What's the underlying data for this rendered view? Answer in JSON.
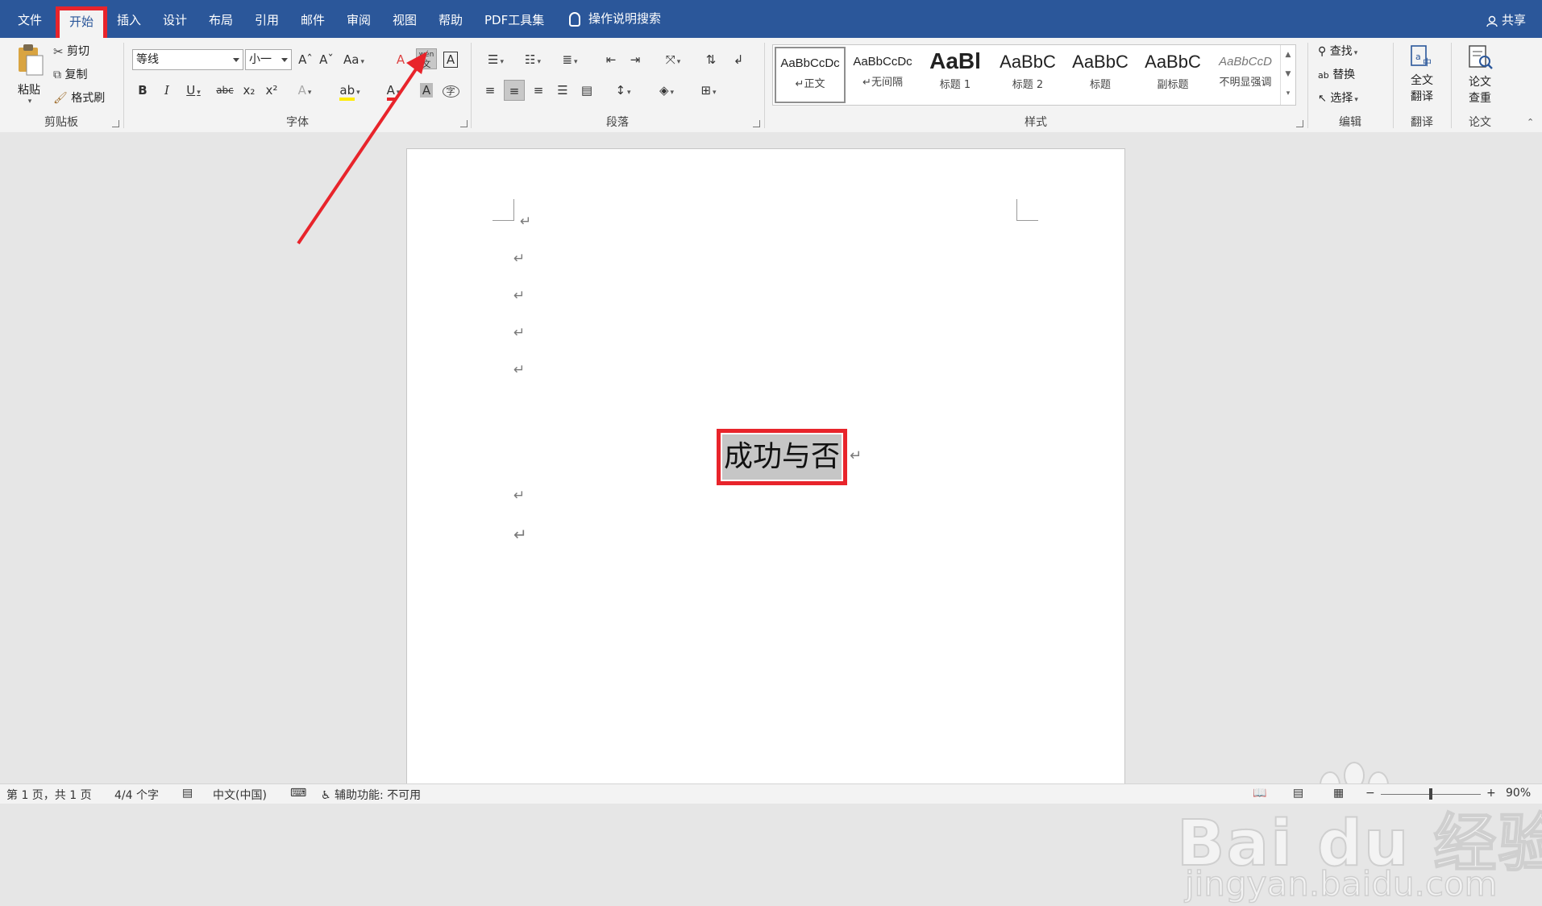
{
  "tabs": [
    "文件",
    "开始",
    "插入",
    "设计",
    "布局",
    "引用",
    "邮件",
    "审阅",
    "视图",
    "帮助",
    "PDF工具集"
  ],
  "active_tab": "开始",
  "tell_me": "操作说明搜索",
  "share": "共享",
  "clipboard": {
    "paste": "粘贴",
    "cut": "剪切",
    "copy": "复制",
    "format_painter": "格式刷",
    "label": "剪贴板"
  },
  "font": {
    "family": "等线",
    "size": "小一",
    "grow": "Aˆ",
    "shrink": "Aˇ",
    "case": "Aa",
    "bold": "B",
    "italic": "I",
    "underline": "U",
    "strike": "abc",
    "subscript": "x₂",
    "superscript": "x²",
    "phonetic_top": "wén",
    "phonetic_bottom": "文",
    "label": "字体"
  },
  "paragraph": {
    "label": "段落"
  },
  "styles": {
    "items": [
      {
        "sample": "AaBbCcDc",
        "name": "↵正文"
      },
      {
        "sample": "AaBbCcDc",
        "name": "↵无间隔"
      },
      {
        "sample": "AaBl",
        "name": "标题 1"
      },
      {
        "sample": "AaBbC",
        "name": "标题 2"
      },
      {
        "sample": "AaBbC",
        "name": "标题"
      },
      {
        "sample": "AaBbC",
        "name": "副标题"
      },
      {
        "sample": "AaBbCcD",
        "name": "不明显强调"
      }
    ],
    "label": "样式"
  },
  "editing": {
    "find": "查找",
    "replace": "替换",
    "select": "选择",
    "label": "编辑"
  },
  "translate": {
    "button_line1": "全文",
    "button_line2": "翻译",
    "label": "翻译"
  },
  "paper": {
    "button_line1": "论文",
    "button_line2": "查重",
    "label": "论文"
  },
  "document": {
    "paragraph_mark": "↵",
    "selected_text": "成功与否"
  },
  "status": {
    "page": "第 1 页，共 1 页",
    "words": "4/4 个字",
    "language": "中文(中国)",
    "accessibility": "辅助功能: 不可用",
    "zoom": "90%",
    "zoom_fraction": 0.5
  },
  "watermark": {
    "brand": "Bai du 经验",
    "url": "jingyan.baidu.com"
  },
  "colors": {
    "tabbar": "#2b579a",
    "highlight": "#e8242b",
    "selection": "#c6c6c6"
  }
}
